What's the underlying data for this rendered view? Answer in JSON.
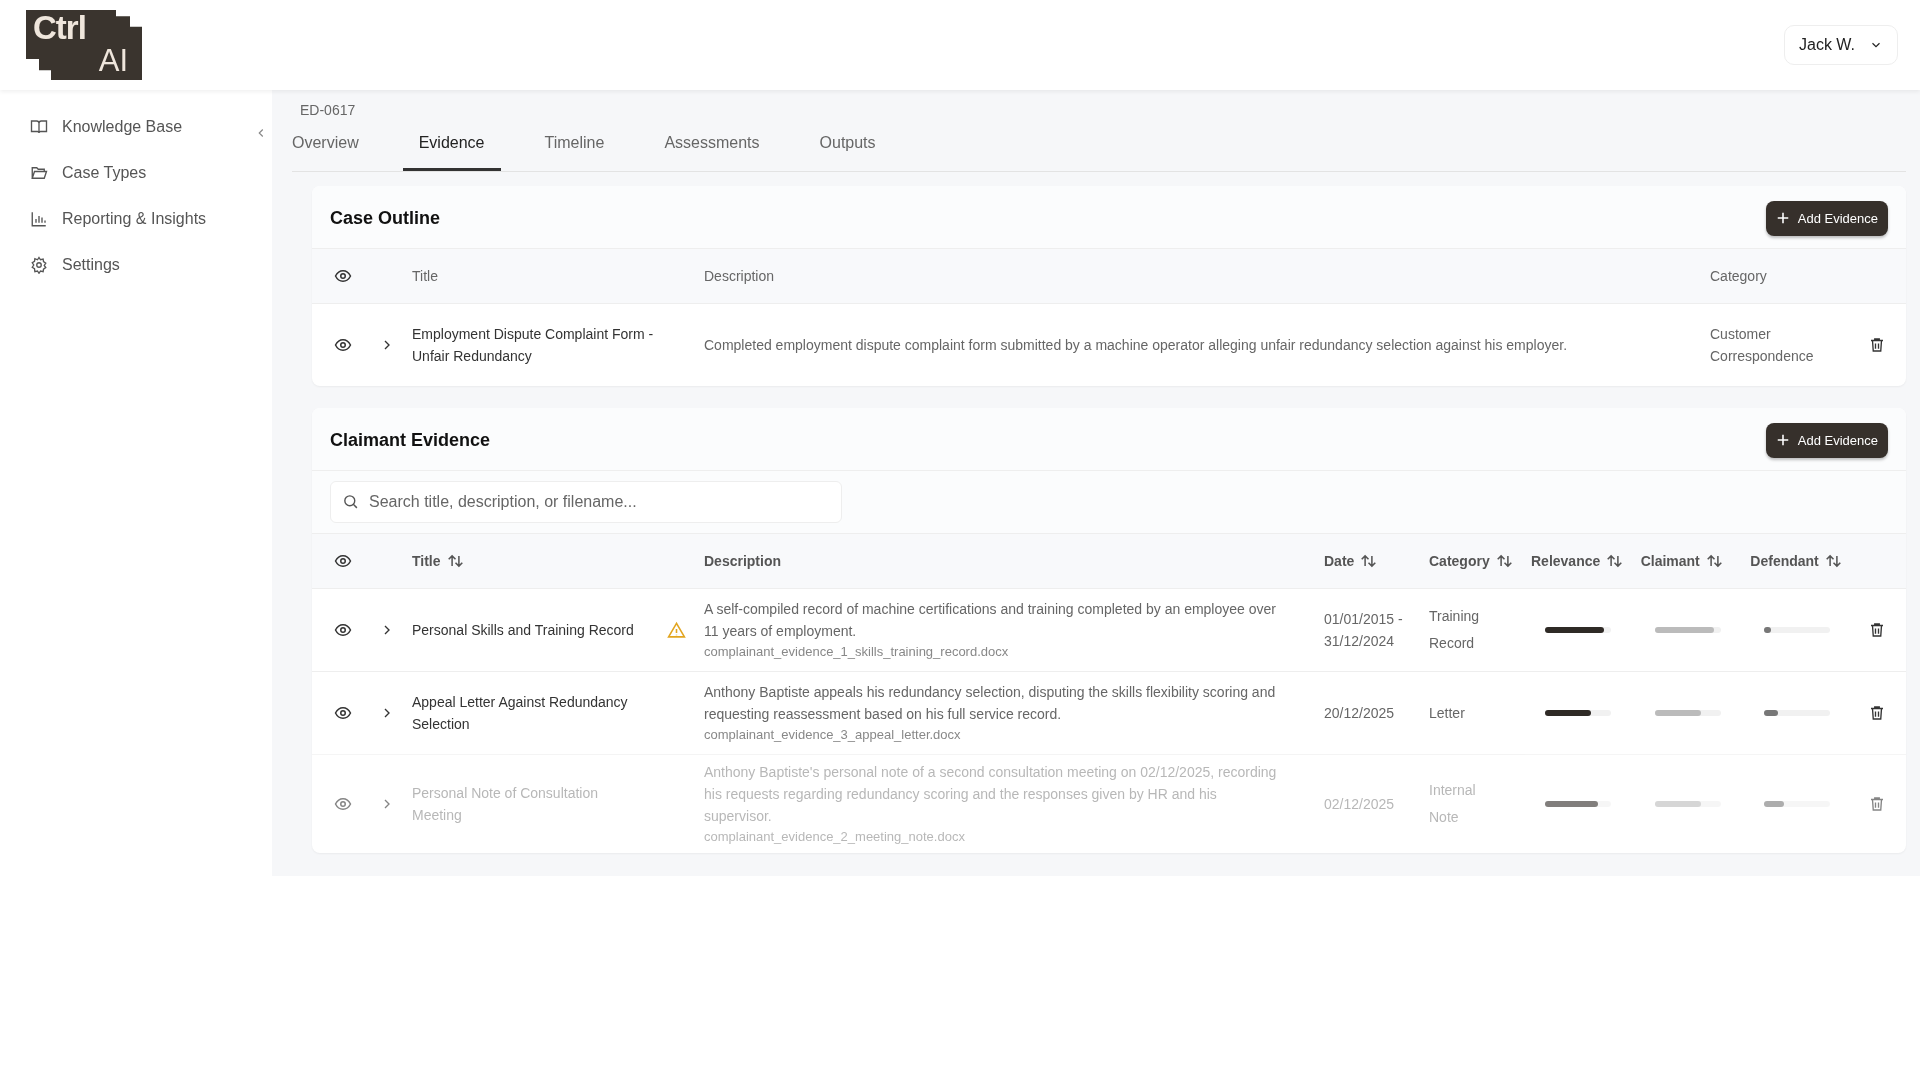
{
  "logo": {
    "line1": "Ctrl",
    "line2": "AI"
  },
  "user_menu": {
    "label": "Jack W."
  },
  "sidebar": {
    "items": [
      {
        "label": "Knowledge Base"
      },
      {
        "label": "Case Types"
      },
      {
        "label": "Reporting & Insights"
      },
      {
        "label": "Settings"
      }
    ]
  },
  "case": {
    "id": "ED-0617"
  },
  "tabs": [
    {
      "label": "Overview",
      "selected": false
    },
    {
      "label": "Evidence",
      "selected": true
    },
    {
      "label": "Timeline",
      "selected": false
    },
    {
      "label": "Assessments",
      "selected": false
    },
    {
      "label": "Outputs",
      "selected": false
    }
  ],
  "case_outline": {
    "title": "Case Outline",
    "add_button": "Add Evidence",
    "columns": [
      "Title",
      "Description",
      "Category"
    ],
    "rows": [
      {
        "title": "Employment Dispute Complaint Form - Unfair Redundancy",
        "description": "Completed employment dispute complaint form submitted by a machine operator alleging unfair redundancy selection against his employer.",
        "category": "Customer Correspondence"
      }
    ]
  },
  "claimant_evidence": {
    "title": "Claimant Evidence",
    "add_button": "Add Evidence",
    "search": {
      "placeholder": "Search title, description, or filename..."
    },
    "columns": [
      "Title",
      "Description",
      "Date",
      "Category",
      "Relevance",
      "Claimant",
      "Defendant"
    ],
    "rows": [
      {
        "title": "Personal Skills and Training Record",
        "warning": true,
        "visible": true,
        "description": "A self-compiled record of machine certifications and training completed by an employee over 11 years of employment.",
        "filename": "complainant_evidence_1_skills_training_record.docx",
        "date": "01/01/2015 - 31/12/2024",
        "category": "Training Record",
        "relevance": {
          "level": 0.9
        },
        "claimant": {
          "level": 0.9
        },
        "defendant": {
          "level": 0.1
        }
      },
      {
        "title": "Appeal Letter Against Redundancy Selection",
        "warning": false,
        "visible": true,
        "description": "Anthony Baptiste appeals his redundancy selection, disputing the skills flexibility scoring and requesting reassessment based on his full service record.",
        "filename": "complainant_evidence_3_appeal_letter.docx",
        "date": "20/12/2025",
        "category": "Letter",
        "relevance": {
          "level": 0.7
        },
        "claimant": {
          "level": 0.7
        },
        "defendant": {
          "level": 0.2
        }
      },
      {
        "title": "Personal Note of Consultation Meeting",
        "warning": false,
        "visible": false,
        "description": "Anthony Baptiste's personal note of a second consultation meeting on 02/12/2025, recording his requests regarding redundancy scoring and the responses given by HR and his supervisor.",
        "filename": "complainant_evidence_2_meeting_note.docx",
        "date": "02/12/2025",
        "category": "Internal Note",
        "relevance": {
          "level": 0.8
        },
        "claimant": {
          "level": 0.7
        },
        "defendant": {
          "level": 0.3
        }
      }
    ]
  }
}
